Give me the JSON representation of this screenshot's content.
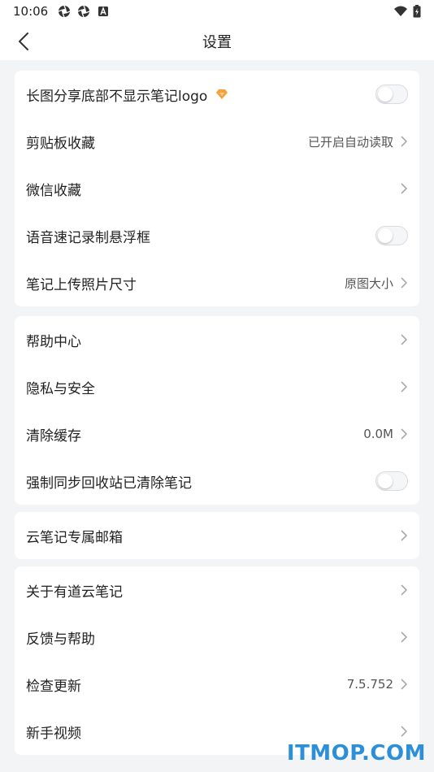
{
  "status_bar": {
    "time": "10:06",
    "icons_left": [
      "aperture-icon",
      "aperture-icon",
      "a-box-icon"
    ],
    "icons_right": [
      "wifi-icon",
      "battery-icon"
    ]
  },
  "header": {
    "title": "设置",
    "back_icon": "chevron-left-icon"
  },
  "groups": [
    {
      "items": [
        {
          "label": "长图分享底部不显示笔记logo",
          "type": "toggle",
          "on": false,
          "badge": "vip-diamond-icon",
          "badge_color": "#f7a13b"
        },
        {
          "label": "剪贴板收藏",
          "type": "link",
          "value": "已开启自动读取"
        },
        {
          "label": "微信收藏",
          "type": "link",
          "value": ""
        },
        {
          "label": "语音速记录制悬浮框",
          "type": "toggle",
          "on": false
        },
        {
          "label": "笔记上传照片尺寸",
          "type": "link",
          "value": "原图大小"
        }
      ]
    },
    {
      "items": [
        {
          "label": "帮助中心",
          "type": "link",
          "value": ""
        },
        {
          "label": "隐私与安全",
          "type": "link",
          "value": ""
        },
        {
          "label": "清除缓存",
          "type": "link",
          "value": "0.0M"
        },
        {
          "label": "强制同步回收站已清除笔记",
          "type": "toggle",
          "on": false
        }
      ]
    },
    {
      "items": [
        {
          "label": "云笔记专属邮箱",
          "type": "link",
          "value": ""
        }
      ]
    },
    {
      "items": [
        {
          "label": "关于有道云笔记",
          "type": "link",
          "value": ""
        },
        {
          "label": "反馈与帮助",
          "type": "link",
          "value": ""
        },
        {
          "label": "检查更新",
          "type": "link",
          "value": "7.5.752"
        },
        {
          "label": "新手视频",
          "type": "link",
          "value": ""
        }
      ]
    }
  ],
  "watermark": "ITMOP.COM",
  "colors": {
    "background": "#f3f4f6",
    "card": "#ffffff",
    "watermark": "#2d8fd8",
    "vip_badge": "#f7a13b"
  }
}
